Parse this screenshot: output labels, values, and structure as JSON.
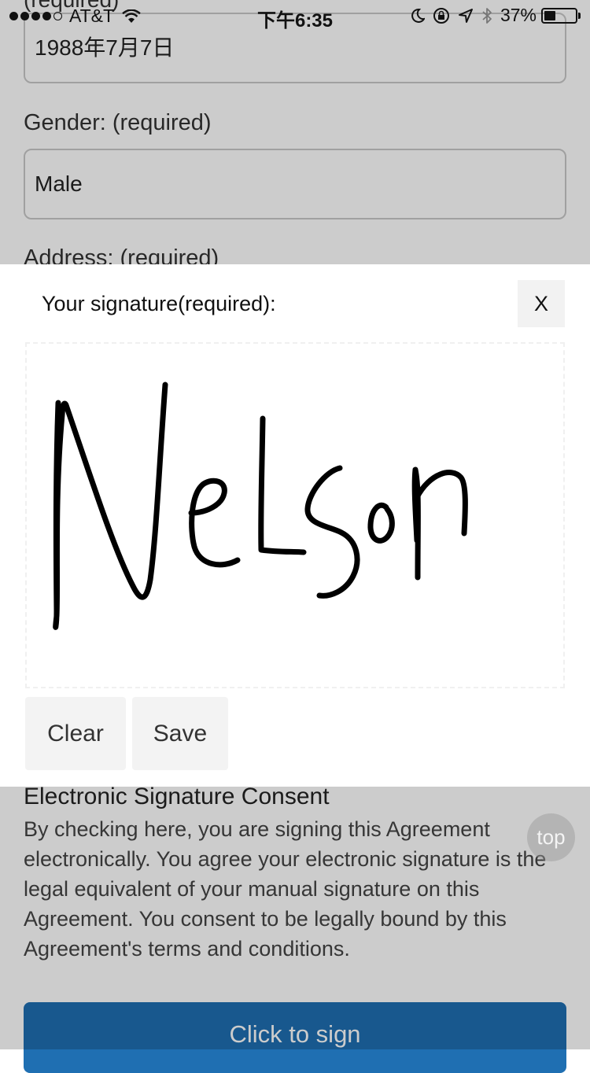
{
  "status_bar": {
    "carrier": "AT&T",
    "time": "下午6:35",
    "battery_percent": "37%",
    "battery_level": 0.37,
    "signal_bars": 4,
    "signal_total": 5
  },
  "form": {
    "dob_value": "1988年7月7日",
    "gender_label": "Gender: (required)",
    "gender_value": "Male",
    "address_label": "Address: (required)"
  },
  "signature_modal": {
    "title": "Your signature(required):",
    "close_label": "X",
    "clear_label": "Clear",
    "save_label": "Save",
    "signature_text": "Nelson"
  },
  "consent": {
    "title": "Electronic Signature Consent",
    "text": "By checking here, you are signing this Agreement electronically. You agree your electronic signature is the legal equivalent of your manual signature on this Agreement. You consent to be legally bound by this Agreement's terms and conditions."
  },
  "sign_button_label": "Click to sign",
  "top_button_label": "top",
  "colors": {
    "primary": "#1f6fb2",
    "overlay": "rgba(0,0,0,0.2)"
  }
}
